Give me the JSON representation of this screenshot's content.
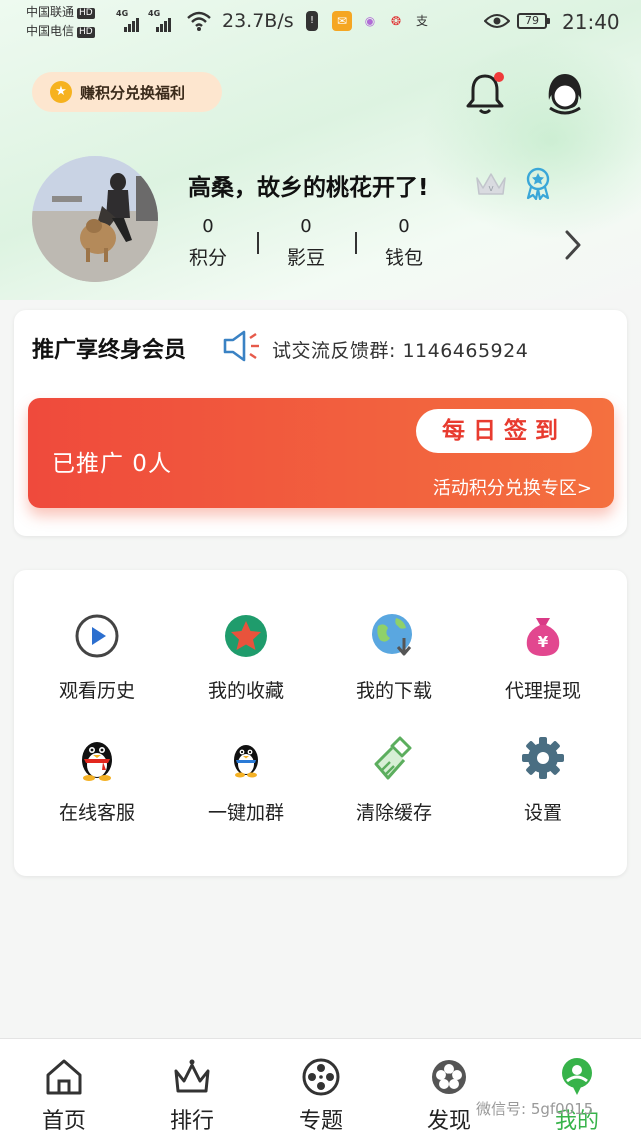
{
  "status_bar": {
    "carrier1": "中国联通",
    "carrier2": "中国电信",
    "hd": "HD",
    "network": "4G",
    "speed": "23.7B/s",
    "battery": "79",
    "time": "21:40"
  },
  "header": {
    "points_badge": "赚积分兑换福利",
    "points_icon": "★"
  },
  "profile": {
    "username": "高桑，故乡的桃花开了!",
    "stats": [
      {
        "value": "0",
        "label": "积分"
      },
      {
        "value": "0",
        "label": "影豆"
      },
      {
        "value": "0",
        "label": "钱包"
      }
    ]
  },
  "promo": {
    "title": "推广享终身会员",
    "marquee": "试交流反馈群: 1146465924",
    "promoted": "已推广 0人",
    "checkin": "每日签到",
    "exchange": "活动积分兑换专区>"
  },
  "grid": [
    {
      "label": "观看历史",
      "icon": "play-circle-icon"
    },
    {
      "label": "我的收藏",
      "icon": "star-icon"
    },
    {
      "label": "我的下载",
      "icon": "globe-download-icon"
    },
    {
      "label": "代理提现",
      "icon": "money-bag-icon"
    },
    {
      "label": "在线客服",
      "icon": "penguin-icon"
    },
    {
      "label": "一键加群",
      "icon": "penguin-icon"
    },
    {
      "label": "清除缓存",
      "icon": "broom-icon"
    },
    {
      "label": "设置",
      "icon": "gear-icon"
    }
  ],
  "nav": [
    {
      "label": "首页",
      "icon": "home-icon"
    },
    {
      "label": "排行",
      "icon": "crown-icon"
    },
    {
      "label": "专题",
      "icon": "film-reel-icon"
    },
    {
      "label": "发现",
      "icon": "flower-icon"
    },
    {
      "label": "我的",
      "icon": "user-icon",
      "active": true
    }
  ],
  "watermark": "微信号: 5gf0015",
  "colors": {
    "accent_green": "#37b34a",
    "banner_red": "#ef4a3c",
    "checkin_text": "#e83b2f",
    "badge_bg": "#fde6cf"
  }
}
